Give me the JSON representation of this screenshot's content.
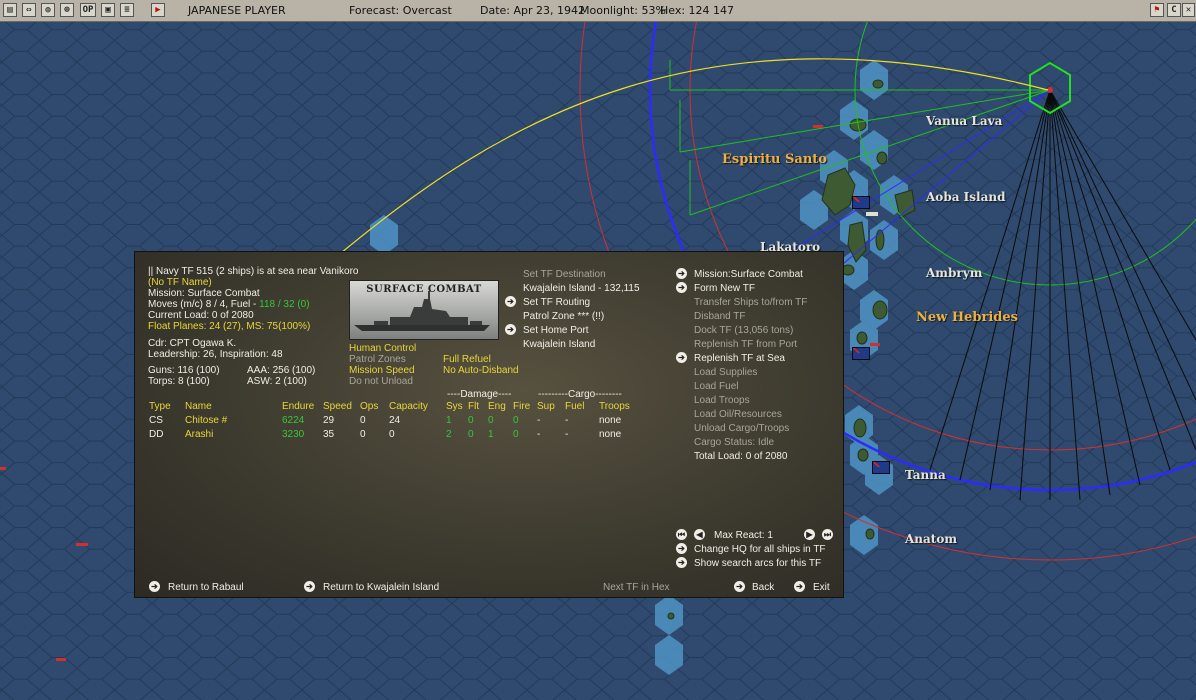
{
  "topbar": {
    "icons": [
      "map-icon",
      "info-icon",
      "globe-icon",
      "target-icon",
      "ops-icon",
      "window-icon",
      "turn-icon"
    ],
    "icon_glyphs": [
      "▤",
      "⇔",
      "◍",
      "⊕",
      "OP",
      "▣",
      "▶"
    ],
    "player": "JAPANESE PLAYER",
    "forecast": "Forecast: Overcast",
    "date": "Date: Apr 23, 1942",
    "moonlight": "Moonlight: 53%",
    "hex": "Hex: 124 147",
    "right_icons": [
      "flag-icon",
      "c-icon",
      "close-icon"
    ],
    "right_glyphs": [
      "⚑",
      "C",
      "✕"
    ]
  },
  "map": {
    "labels": {
      "vanua_lava": "Vanua Lava",
      "espiritu_santo": "Espiritu Santo",
      "aoba": "Aoba Island",
      "lakatoro": "Lakatoro",
      "ambrym": "Ambrym",
      "new_hebrides": "New Hebrides",
      "tanna": "Tanna",
      "anatom": "Anatom"
    }
  },
  "tf": {
    "header": "|| Navy TF 515 (2 ships) is at sea near Vanikoro",
    "name": "(No TF Name)",
    "mission": "Mission: Surface Combat",
    "moves_prefix": "Moves (m/c)  8 / 4, Fuel - ",
    "moves_fuel": "118 / 32 (0)",
    "current_load": "Current Load:  0 of 2080",
    "float_planes": "Float Planes: 24 (27), MS: 75(100%)",
    "cdr": "Cdr: CPT  Ogawa K.",
    "leadership": "Leadership: 26, Inspiration: 48",
    "guns": "Guns: 116 (100)",
    "aaa": "AAA: 256 (100)",
    "torps": "Torps: 8 (100)",
    "asw": "ASW: 2 (100)",
    "image_label": "SURFACE COMBAT",
    "options": {
      "human_control": "Human Control",
      "patrol_zones": "Patrol Zones",
      "mission_speed": "Mission Speed",
      "do_not_unload": "Do not Unload",
      "full_refuel": "Full Refuel",
      "no_auto_disband": "No Auto-Disband"
    }
  },
  "destination": {
    "set_dest": "Set TF Destination",
    "dest_value": "Kwajalein Island - 132,115",
    "set_routing": "Set TF Routing",
    "patrol_zone": "Patrol Zone  *** (!!)",
    "set_home": "Set Home Port",
    "home_value": "Kwajalein Island"
  },
  "commands": {
    "mission": "Mission:Surface Combat",
    "form_new": "Form New TF",
    "transfer": "Transfer Ships to/from TF",
    "disband": "Disband TF",
    "dock": "Dock TF (13,056 tons)",
    "replenish_port": "Replenish TF from Port",
    "replenish_sea": "Replenish TF at Sea",
    "load_supplies": "Load Supplies",
    "load_fuel": "Load Fuel",
    "load_troops": "Load Troops",
    "load_oil": "Load Oil/Resources",
    "unload": "Unload Cargo/Troops",
    "cargo_status": "Cargo Status: Idle",
    "total_load": "Total Load: 0 of 2080"
  },
  "table": {
    "damage_header": "----Damage----",
    "cargo_header": "---------Cargo--------",
    "columns": [
      "Type",
      "Name",
      "Endure",
      "Speed",
      "Ops",
      "Capacity",
      "Sys",
      "Flt",
      "Eng",
      "Fire",
      "Sup",
      "Fuel",
      "Troops"
    ],
    "rows": [
      [
        "CS",
        "Chitose #",
        "6224",
        "29",
        "0",
        "24",
        "1",
        "0",
        "0",
        "0",
        "-",
        "-",
        "none"
      ],
      [
        "DD",
        "Arashi",
        "3230",
        "35",
        "0",
        "0",
        "2",
        "0",
        "1",
        "0",
        "-",
        "-",
        "none"
      ]
    ]
  },
  "bottom": {
    "max_react": "Max React:  1",
    "change_hq": "Change HQ for all ships in TF",
    "show_search": "Show search arcs for this TF",
    "return_rabaul": "Return to Rabaul",
    "return_kwaj": "Return to Kwajalein Island",
    "next_tf": "Next TF in Hex",
    "back": "Back",
    "exit": "Exit"
  }
}
